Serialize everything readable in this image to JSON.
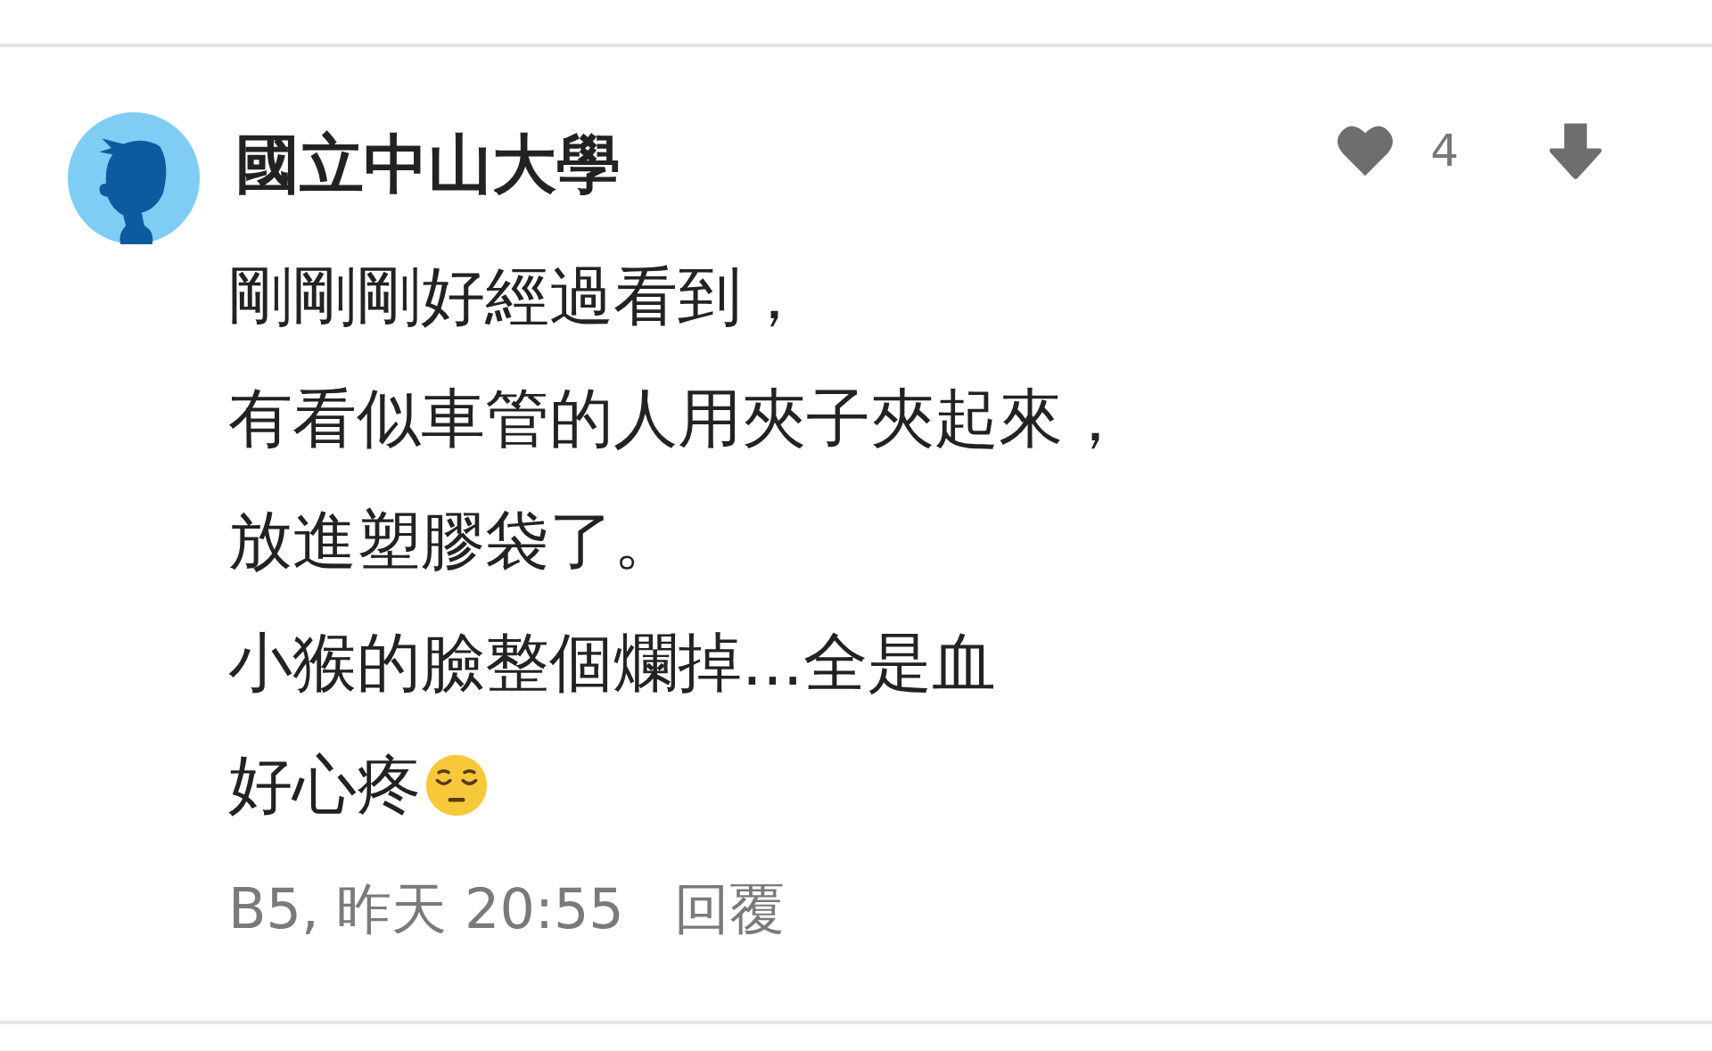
{
  "comment": {
    "author": "國立中山大學",
    "likes": "4",
    "body_lines": [
      {
        "kind": "plain",
        "text": "剛剛剛好經過看到，"
      },
      {
        "kind": "plain",
        "text": "有看似車管的人用夾子夾起來，"
      },
      {
        "kind": "plain",
        "text": "放進塑膠袋了。"
      },
      {
        "kind": "plain",
        "text": "小猴的臉整個爛掉...全是血"
      },
      {
        "kind": "emoji",
        "text": "好心疼"
      }
    ],
    "meta": "B5, 昨天 20:55",
    "reply": "回覆"
  }
}
